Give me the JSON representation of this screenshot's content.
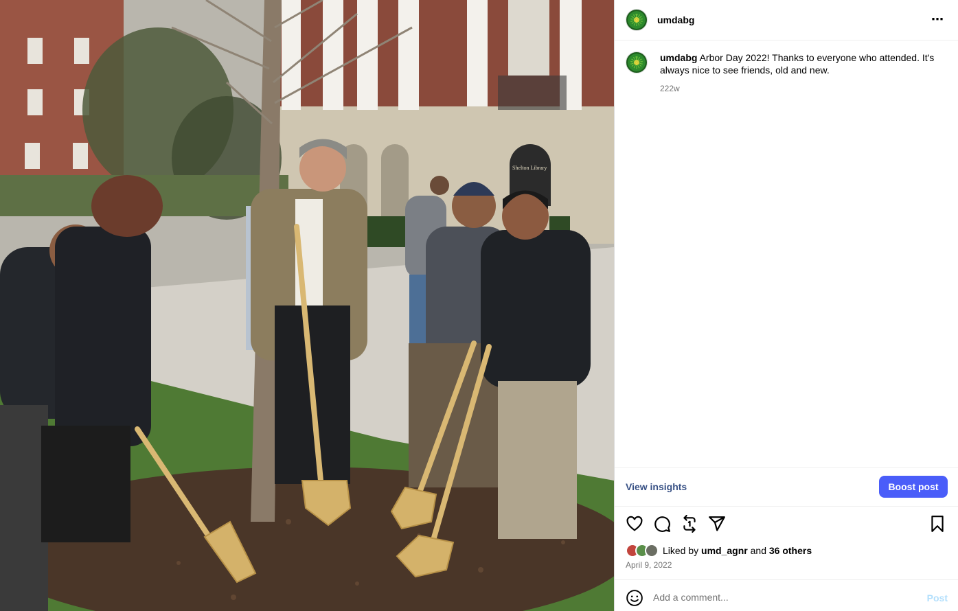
{
  "post": {
    "username": "umdabg",
    "more_icon": "more-horizontal-icon",
    "caption_text": "Arbor Day 2022! Thanks to everyone who attended. It's always nice to see friends, old and new.",
    "time_ago": "222w",
    "view_insights": "View insights",
    "boost_label": "Boost post",
    "liked_prefix": "Liked by",
    "liked_user": "umd_agnr",
    "liked_and": "and",
    "liked_others": "36 others",
    "date": "April 9, 2022",
    "comment_placeholder": "Add a comment...",
    "post_label": "Post"
  },
  "photo": {
    "sign_text": "Shelton Library"
  },
  "icons": [
    "heart-icon",
    "comment-icon",
    "repost-icon",
    "share-icon",
    "bookmark-icon",
    "emoji-icon"
  ],
  "colors": {
    "link": "#385185",
    "boost": "#4a5df9",
    "post_disabled": "#b2dffc",
    "muted": "#737373"
  }
}
